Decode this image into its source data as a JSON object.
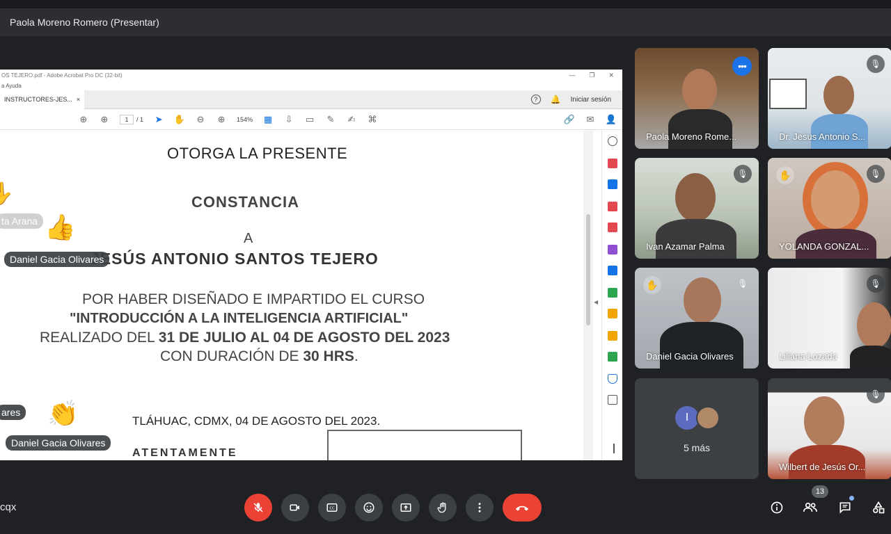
{
  "presenter_bar": {
    "title": "Paola Moreno Romero (Presentar)"
  },
  "acrobat": {
    "window_title": "OS TEJERO.pdf - Adobe Acrobat Pro DC (32-bit)",
    "menu_item": "a   Ayuda",
    "tab_label": "INSTRUCTORES-JES...",
    "tab_close": "×",
    "help_icon": "?",
    "signin": "Iniciar sesión",
    "page_current": "1",
    "page_total": "/ 1",
    "zoom": "154%"
  },
  "document": {
    "line1": "OTORGA LA PRESENTE",
    "line2": "CONSTANCIA",
    "line3": "A",
    "line4": "JESÚS ANTONIO SANTOS TEJERO",
    "line5": "POR HABER DISEÑADO E IMPARTIDO EL CURSO",
    "line6": "\"INTRODUCCIÓN A LA INTELIGENCIA ARTIFICIAL\"",
    "line7_a": "REALIZADO DEL ",
    "line7_b": "31 DE JULIO AL 04 DE AGOSTO DEL 2023",
    "line8_a": "CON DURACIÓN DE ",
    "line8_b": "30 HRS",
    "line8_c": ".",
    "line9": "TLÁHUAC, CDMX, 04 DE AGOSTO DEL 2023.",
    "line10": "ATENTAMENTE"
  },
  "reactions": {
    "tag1": "ta Arana",
    "tag2": "Daniel Gacia Olivares",
    "tag3": "ares",
    "tag4": "Daniel Gacia Olivares",
    "emoji_thumb": "👍",
    "emoji_clap": "👏",
    "emoji_hand": "✋"
  },
  "participants": [
    {
      "name": "Paola Moreno Rome..."
    },
    {
      "name": "Dr. Jesus Antonio S..."
    },
    {
      "name": "Ivan Azamar Palma"
    },
    {
      "name": "YOLANDA GONZAL..."
    },
    {
      "name": "Daniel Gacia Olivares"
    },
    {
      "name": "Liliana Lozada"
    },
    {
      "name": "Wilbert de Jesús Or..."
    }
  ],
  "more_tile": {
    "initial": "I",
    "label": "5 más"
  },
  "bottom": {
    "meeting_code": "cqx",
    "participant_count": "13"
  },
  "colors": {
    "accent": "#8ab4f8",
    "danger": "#ea4335",
    "bg": "#202124"
  }
}
